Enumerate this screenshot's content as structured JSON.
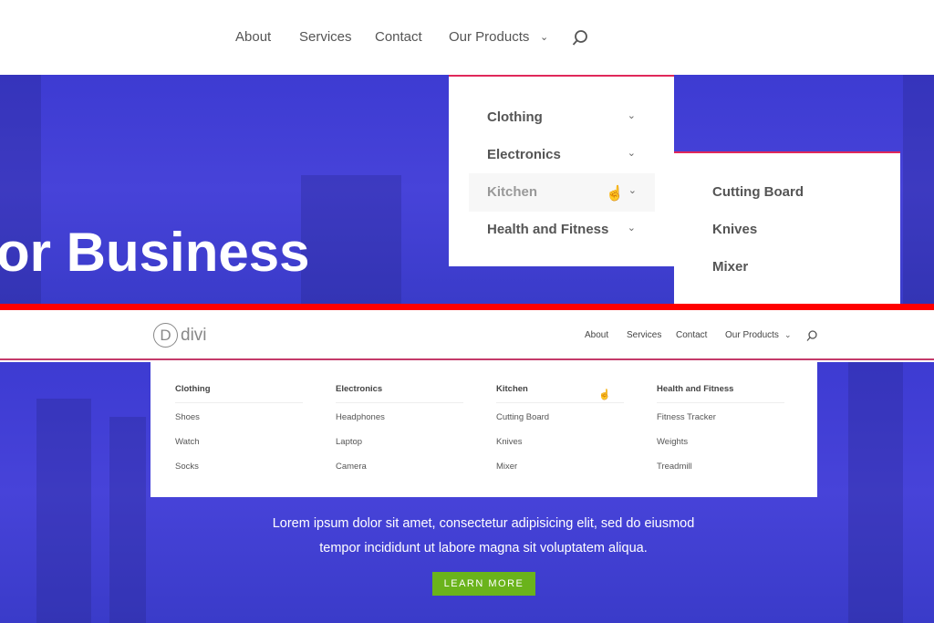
{
  "top": {
    "nav": [
      "About",
      "Services",
      "Contact",
      "Our Products"
    ],
    "hero_title": "or Business",
    "menu": [
      {
        "label": "Clothing"
      },
      {
        "label": "Electronics"
      },
      {
        "label": "Kitchen",
        "hovered": true
      },
      {
        "label": "Health and Fitness"
      }
    ],
    "submenu": [
      "Cutting Board",
      "Knives",
      "Mixer"
    ]
  },
  "bottom": {
    "logo_letter": "D",
    "logo_text": "divi",
    "nav": [
      "About",
      "Services",
      "Contact",
      "Our Products"
    ],
    "mega": [
      {
        "title": "Clothing",
        "items": [
          "Shoes",
          "Watch",
          "Socks"
        ]
      },
      {
        "title": "Electronics",
        "items": [
          "Headphones",
          "Laptop",
          "Camera"
        ]
      },
      {
        "title": "Kitchen",
        "items": [
          "Cutting Board",
          "Knives",
          "Mixer"
        ]
      },
      {
        "title": "Health and Fitness",
        "items": [
          "Fitness Tracker",
          "Weights",
          "Treadmill"
        ]
      }
    ],
    "lorem1": "Lorem ipsum dolor sit amet, consectetur adipisicing elit, sed do eiusmod",
    "lorem2": "tempor incididunt ut labore magna sit voluptatem aliqua.",
    "cta": "LEARN MORE"
  },
  "colors": {
    "hero": "#4141d6",
    "accent": "#e0285a",
    "divider": "#ff0000",
    "cta": "#6ab31b"
  }
}
